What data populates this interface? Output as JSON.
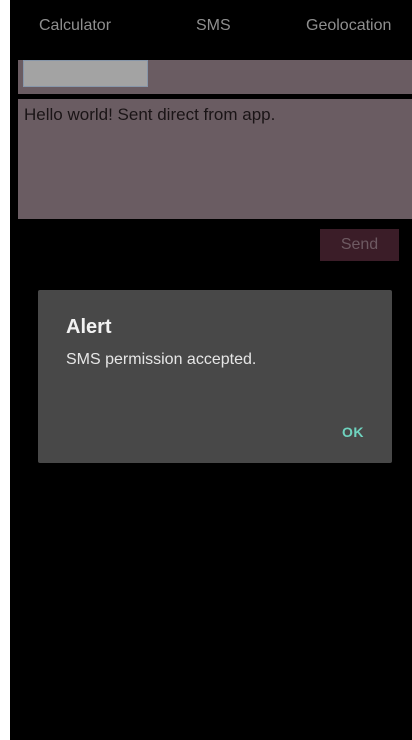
{
  "tabs": [
    {
      "label": "Calculator"
    },
    {
      "label": "SMS"
    },
    {
      "label": "Geolocation"
    }
  ],
  "sms": {
    "phone_value": "",
    "message_text": "Hello world! Sent direct from app.",
    "send_label": "Send"
  },
  "dialog": {
    "title": "Alert",
    "message": "SMS permission accepted.",
    "ok_label": "OK"
  },
  "colors": {
    "background": "#000000",
    "field_background": "#6a5c62",
    "send_button_background": "#3b1d28",
    "dialog_background": "#484848",
    "accent": "#6fd3bf"
  }
}
